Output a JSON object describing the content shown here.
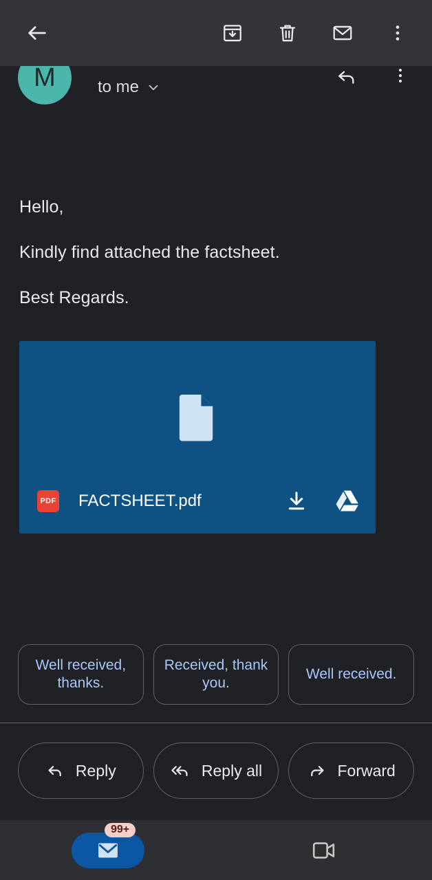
{
  "appbar": {
    "back_label": "Back",
    "icons": [
      {
        "name": "archive-icon",
        "label": "Archive"
      },
      {
        "name": "delete-icon",
        "label": "Delete"
      },
      {
        "name": "mark-unread-icon",
        "label": "Mark as unread"
      },
      {
        "name": "more-options-icon",
        "label": "More options"
      }
    ]
  },
  "sender": {
    "avatar_initial": "M",
    "avatar_color": "#4db6ac",
    "recipient": "to me",
    "expand_icon": "chevron-down-icon",
    "reply_icon": "reply-icon",
    "more_icon": "more-options-icon"
  },
  "message": {
    "greeting": "Hello,",
    "body": "Kindly find attached the factsheet.",
    "signoff": "Best Regards."
  },
  "attachment": {
    "filename": "FACTSHEET.pdf",
    "type_badge": "PDF",
    "badge_color": "#ea4335",
    "card_color": "#0e5283",
    "preview_icon": "document-icon",
    "download_icon": "download-icon",
    "drive_icon": "google-drive-icon"
  },
  "smart_replies": [
    "Well received, thanks.",
    "Received, thank you.",
    "Well received."
  ],
  "actions": [
    {
      "label": "Reply",
      "icon": "reply-icon"
    },
    {
      "label": "Reply all",
      "icon": "reply-all-icon"
    },
    {
      "label": "Forward",
      "icon": "forward-icon"
    }
  ],
  "bottom_nav": {
    "mail": {
      "icon": "mail-icon",
      "badge": "99+",
      "selected_color": "#0b57a4"
    },
    "meet": {
      "icon": "video-camera-icon"
    }
  }
}
